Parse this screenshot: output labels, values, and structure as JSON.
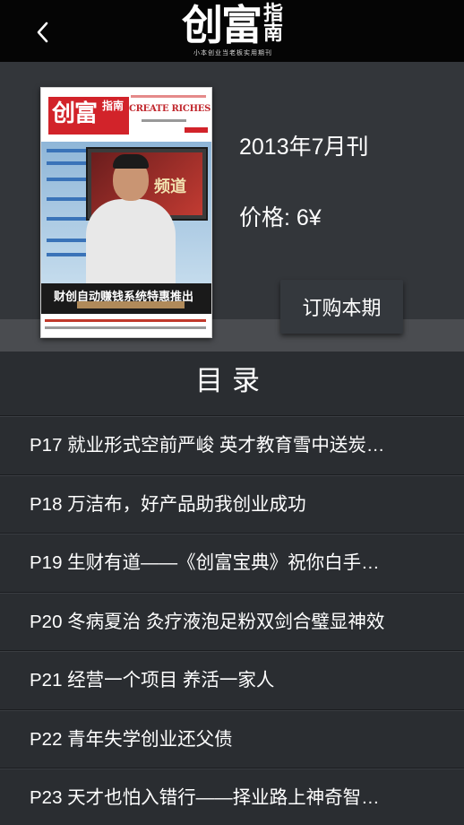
{
  "header": {
    "logo_main": "创富",
    "logo_side": "指南",
    "logo_subtitle": "小本创业当老板实用期刊"
  },
  "cover": {
    "logo_main": "创富",
    "logo_side": "指南",
    "english_title": "CREATE RICHES",
    "tv_text": "频道",
    "headline": "财创自动赚钱系统特惠推出"
  },
  "issue": {
    "title": "2013年7月刊",
    "price": "价格: 6¥",
    "order_label": "订购本期"
  },
  "toc": {
    "title": "目录",
    "items": [
      "P17 就业形式空前严峻 英才教育雪中送炭…",
      "P18 万洁布，好产品助我创业成功",
      "P19 生财有道——《创富宝典》祝你白手…",
      "P20 冬病夏治 灸疗液泡足粉双剑合璧显神效",
      "P21 经营一个项目 养活一家人",
      "P22 青年失学创业还父债",
      "P23 天才也怕入错行——择业路上神奇智…"
    ]
  },
  "colors": {
    "topbar": "#050505",
    "hero_bg": "#33363a",
    "band": "#4a4c50",
    "list_bg": "#2a2d31",
    "cover_red": "#d2232a"
  }
}
